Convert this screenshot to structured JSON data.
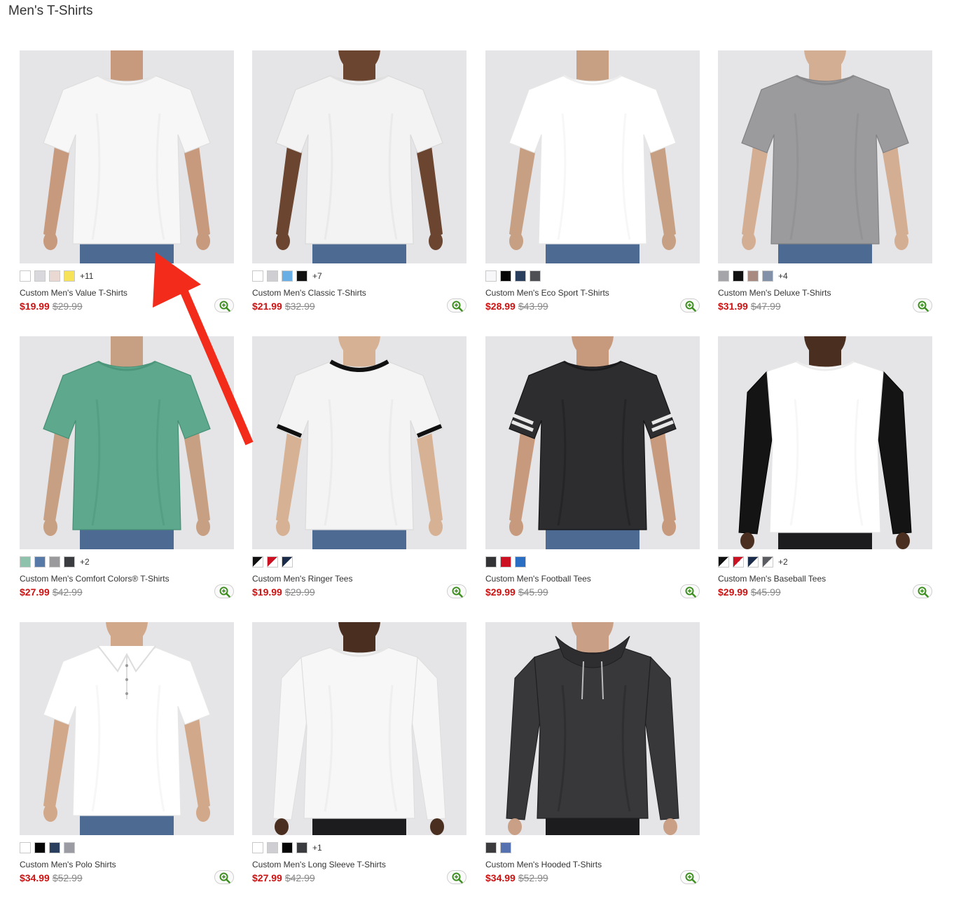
{
  "page": {
    "title": "Men's T-Shirts"
  },
  "colors": {
    "sale_price": "#cc1111",
    "original_price": "#888888",
    "zoom_icon": "#3d8f1f",
    "annotation_arrow": "#f22b1b",
    "image_bg": "#e5e5e7"
  },
  "products": [
    {
      "name": "Custom Men's Value T-Shirts",
      "price": "$19.99",
      "original_price": "$29.99",
      "shirt_color": "#f7f7f7",
      "style": "tee",
      "swatches": [
        "#ffffff",
        "#d9d9dd",
        "#ead8d2",
        "#f6e35a"
      ],
      "more": "+11"
    },
    {
      "name": "Custom Men's Classic T-Shirts",
      "price": "$21.99",
      "original_price": "$32.99",
      "shirt_color": "#f3f3f3",
      "style": "tee",
      "swatches": [
        "#ffffff",
        "#cfcfd3",
        "#6aaee6",
        "#111111"
      ],
      "more": "+7"
    },
    {
      "name": "Custom Men's Eco Sport T-Shirts",
      "price": "$28.99",
      "original_price": "$43.99",
      "shirt_color": "#ffffff",
      "style": "tee",
      "swatches": [
        "#f7f7f9",
        "#050505",
        "#2a3e5e",
        "#4d4f55"
      ],
      "more": ""
    },
    {
      "name": "Custom Men's Deluxe T-Shirts",
      "price": "$31.99",
      "original_price": "$47.99",
      "shirt_color": "#9b9b9d",
      "style": "tee",
      "swatches": [
        "#a5a5a9",
        "#111111",
        "#a88a80",
        "#8290a8"
      ],
      "more": "+4"
    },
    {
      "name": "Custom Men's Comfort Colors® T-Shirts",
      "price": "$27.99",
      "original_price": "$42.99",
      "shirt_color": "#5ea88d",
      "style": "tee",
      "swatches": [
        "#8fc2ad",
        "#5679a8",
        "#9a9a9c",
        "#3b3c40"
      ],
      "more": "+2"
    },
    {
      "name": "Custom Men's Ringer Tees",
      "price": "$19.99",
      "original_price": "$29.99",
      "shirt_color": "#f4f4f4",
      "style": "ringer",
      "swatches": [
        [
          "#ffffff",
          "#111111"
        ],
        [
          "#ffffff",
          "#cc1122"
        ],
        [
          "#ffffff",
          "#1b2c4a"
        ]
      ],
      "more": ""
    },
    {
      "name": "Custom Men's Football Tees",
      "price": "$29.99",
      "original_price": "$45.99",
      "shirt_color": "#2d2d30",
      "style": "football",
      "swatches": [
        "#333336",
        "#cc1122",
        "#2a6ec4"
      ],
      "more": ""
    },
    {
      "name": "Custom Men's Baseball Tees",
      "price": "$29.99",
      "original_price": "$45.99",
      "shirt_color": "#ffffff",
      "style": "raglan",
      "swatches": [
        [
          "#ffffff",
          "#111111"
        ],
        [
          "#ffffff",
          "#cc1122"
        ],
        [
          "#ffffff",
          "#1b2c4a"
        ],
        [
          "#ffffff",
          "#5a5c62"
        ]
      ],
      "more": "+2"
    },
    {
      "name": "Custom Men's Polo Shirts",
      "price": "$34.99",
      "original_price": "$52.99",
      "shirt_color": "#ffffff",
      "style": "polo",
      "swatches": [
        "#ffffff",
        "#050505",
        "#2a3e5e",
        "#9a9ba3"
      ],
      "more": ""
    },
    {
      "name": "Custom Men's Long Sleeve T-Shirts",
      "price": "$27.99",
      "original_price": "$42.99",
      "shirt_color": "#f7f7f7",
      "style": "longsleeve",
      "swatches": [
        "#ffffff",
        "#cfcfd3",
        "#050505",
        "#3b3c40"
      ],
      "more": "+1"
    },
    {
      "name": "Custom Men's Hooded T-Shirts",
      "price": "$34.99",
      "original_price": "$52.99",
      "shirt_color": "#38383b",
      "style": "hooded",
      "swatches": [
        "#3b3b3e",
        "#5671b0"
      ],
      "more": ""
    }
  ]
}
